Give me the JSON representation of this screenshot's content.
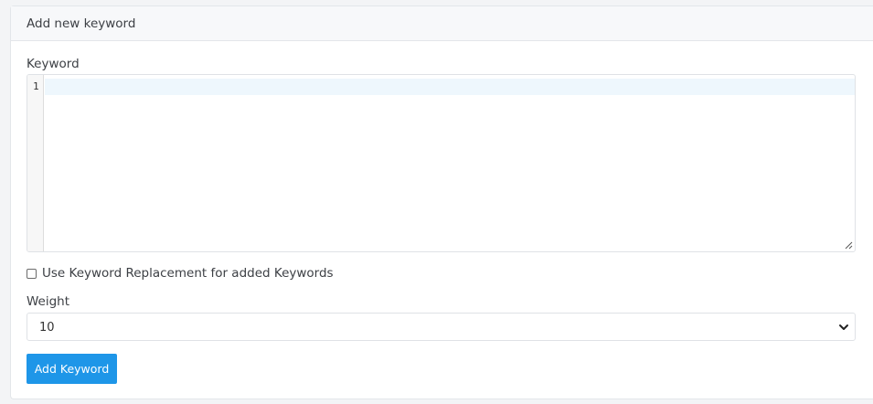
{
  "panel": {
    "title": "Add new keyword"
  },
  "keyword": {
    "label": "Keyword",
    "line_numbers": [
      "1"
    ],
    "value": ""
  },
  "replacement": {
    "label": "Use Keyword Replacement for added Keywords",
    "checked": false
  },
  "weight": {
    "label": "Weight",
    "selected": "10"
  },
  "actions": {
    "add_label": "Add Keyword"
  },
  "colors": {
    "primary": "#1e96e8",
    "active_line": "#eef7fd"
  }
}
